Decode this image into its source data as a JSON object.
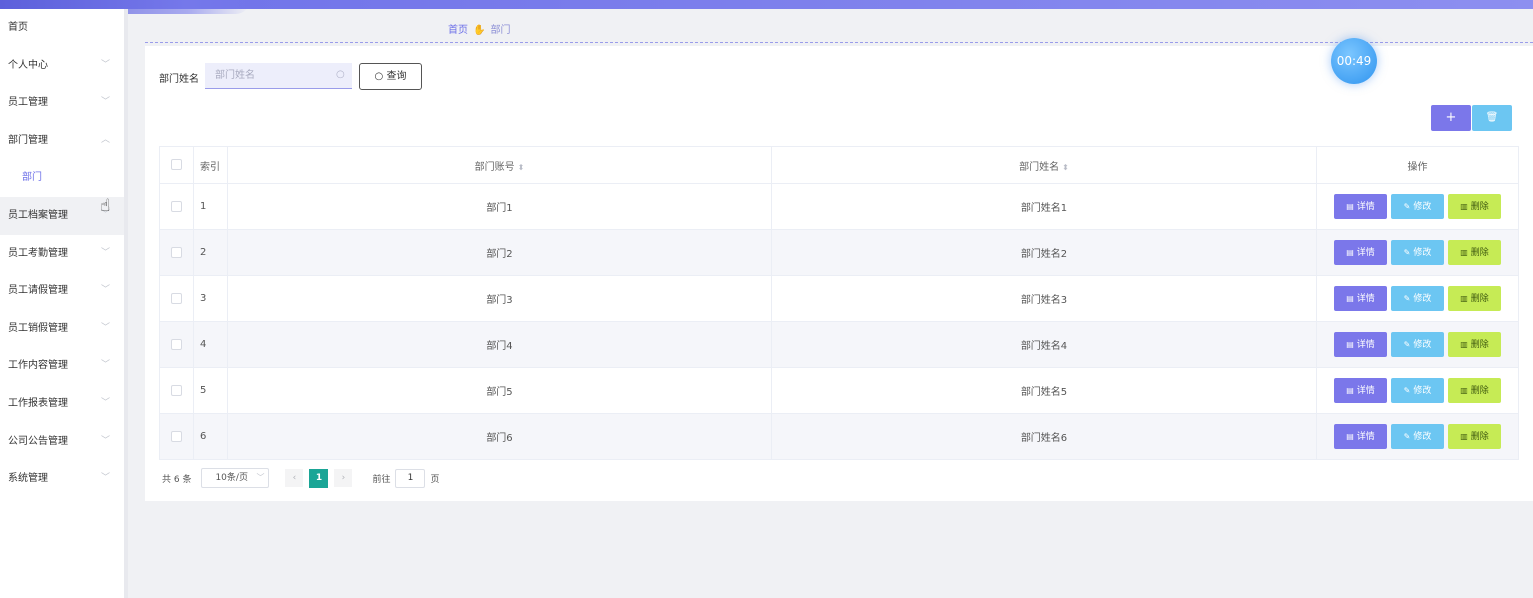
{
  "sidebar": {
    "items": [
      {
        "label": "首页",
        "has_chevron": false
      },
      {
        "label": "个人中心",
        "has_chevron": true
      },
      {
        "label": "员工管理",
        "has_chevron": true
      },
      {
        "label": "部门管理",
        "has_chevron": true,
        "expanded": true
      },
      {
        "label": "部门",
        "sub": true
      },
      {
        "label": "员工档案管理",
        "has_chevron": true
      },
      {
        "label": "员工考勤管理",
        "has_chevron": true
      },
      {
        "label": "员工请假管理",
        "has_chevron": true
      },
      {
        "label": "员工销假管理",
        "has_chevron": true
      },
      {
        "label": "工作内容管理",
        "has_chevron": true
      },
      {
        "label": "工作报表管理",
        "has_chevron": true
      },
      {
        "label": "公司公告管理",
        "has_chevron": true
      },
      {
        "label": "系统管理",
        "has_chevron": true
      }
    ]
  },
  "breadcrumb": {
    "home": "首页",
    "current": "部门"
  },
  "timer": "00:49",
  "search": {
    "label": "部门姓名",
    "placeholder": "部门姓名",
    "value": "",
    "button": "查询"
  },
  "toolbar": {
    "add_icon": "+",
    "delete_icon": "🗑"
  },
  "table": {
    "headers": {
      "index": "索引",
      "account": "部门账号",
      "name": "部门姓名",
      "ops": "操作"
    },
    "rows": [
      {
        "index": "1",
        "account": "部门1",
        "name": "部门姓名1"
      },
      {
        "index": "2",
        "account": "部门2",
        "name": "部门姓名2"
      },
      {
        "index": "3",
        "account": "部门3",
        "name": "部门姓名3"
      },
      {
        "index": "4",
        "account": "部门4",
        "name": "部门姓名4"
      },
      {
        "index": "5",
        "account": "部门5",
        "name": "部门姓名5"
      },
      {
        "index": "6",
        "account": "部门6",
        "name": "部门姓名6"
      }
    ],
    "actions": {
      "detail": "详情",
      "edit": "修改",
      "delete": "删除"
    }
  },
  "pagination": {
    "total": "共 6 条",
    "page_size": "10条/页",
    "current_page": "1",
    "goto_label": "前往",
    "goto_value": "1",
    "goto_suffix": "页"
  },
  "colors": {
    "primary": "#6d70e8",
    "detail_btn": "#7b77ea",
    "edit_btn": "#6cc6f2",
    "delete_btn": "#c6eb55",
    "pager_active": "#1aa596"
  }
}
